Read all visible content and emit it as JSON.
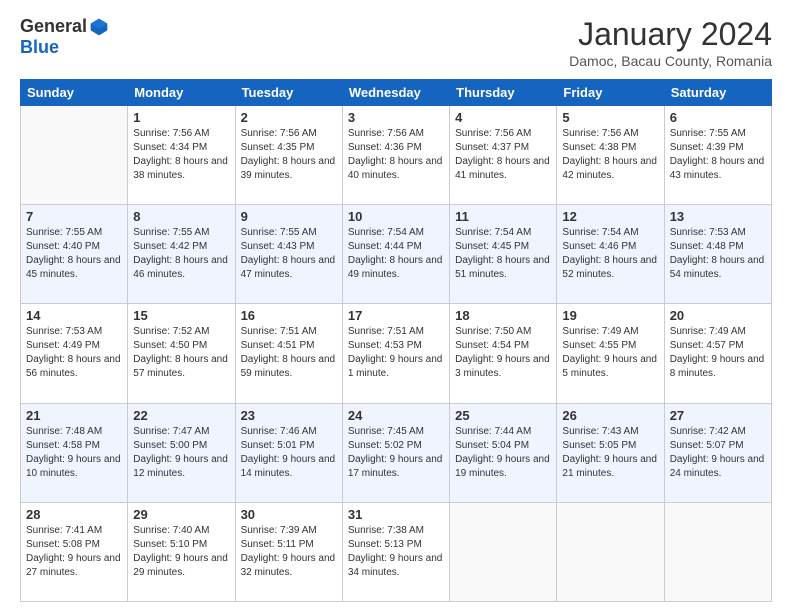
{
  "header": {
    "logo_general": "General",
    "logo_blue": "Blue",
    "month_title": "January 2024",
    "subtitle": "Damoc, Bacau County, Romania"
  },
  "weekdays": [
    "Sunday",
    "Monday",
    "Tuesday",
    "Wednesday",
    "Thursday",
    "Friday",
    "Saturday"
  ],
  "weeks": [
    [
      {
        "day": "",
        "sunrise": "",
        "sunset": "",
        "daylight": ""
      },
      {
        "day": "1",
        "sunrise": "Sunrise: 7:56 AM",
        "sunset": "Sunset: 4:34 PM",
        "daylight": "Daylight: 8 hours and 38 minutes."
      },
      {
        "day": "2",
        "sunrise": "Sunrise: 7:56 AM",
        "sunset": "Sunset: 4:35 PM",
        "daylight": "Daylight: 8 hours and 39 minutes."
      },
      {
        "day": "3",
        "sunrise": "Sunrise: 7:56 AM",
        "sunset": "Sunset: 4:36 PM",
        "daylight": "Daylight: 8 hours and 40 minutes."
      },
      {
        "day": "4",
        "sunrise": "Sunrise: 7:56 AM",
        "sunset": "Sunset: 4:37 PM",
        "daylight": "Daylight: 8 hours and 41 minutes."
      },
      {
        "day": "5",
        "sunrise": "Sunrise: 7:56 AM",
        "sunset": "Sunset: 4:38 PM",
        "daylight": "Daylight: 8 hours and 42 minutes."
      },
      {
        "day": "6",
        "sunrise": "Sunrise: 7:55 AM",
        "sunset": "Sunset: 4:39 PM",
        "daylight": "Daylight: 8 hours and 43 minutes."
      }
    ],
    [
      {
        "day": "7",
        "sunrise": "Sunrise: 7:55 AM",
        "sunset": "Sunset: 4:40 PM",
        "daylight": "Daylight: 8 hours and 45 minutes."
      },
      {
        "day": "8",
        "sunrise": "Sunrise: 7:55 AM",
        "sunset": "Sunset: 4:42 PM",
        "daylight": "Daylight: 8 hours and 46 minutes."
      },
      {
        "day": "9",
        "sunrise": "Sunrise: 7:55 AM",
        "sunset": "Sunset: 4:43 PM",
        "daylight": "Daylight: 8 hours and 47 minutes."
      },
      {
        "day": "10",
        "sunrise": "Sunrise: 7:54 AM",
        "sunset": "Sunset: 4:44 PM",
        "daylight": "Daylight: 8 hours and 49 minutes."
      },
      {
        "day": "11",
        "sunrise": "Sunrise: 7:54 AM",
        "sunset": "Sunset: 4:45 PM",
        "daylight": "Daylight: 8 hours and 51 minutes."
      },
      {
        "day": "12",
        "sunrise": "Sunrise: 7:54 AM",
        "sunset": "Sunset: 4:46 PM",
        "daylight": "Daylight: 8 hours and 52 minutes."
      },
      {
        "day": "13",
        "sunrise": "Sunrise: 7:53 AM",
        "sunset": "Sunset: 4:48 PM",
        "daylight": "Daylight: 8 hours and 54 minutes."
      }
    ],
    [
      {
        "day": "14",
        "sunrise": "Sunrise: 7:53 AM",
        "sunset": "Sunset: 4:49 PM",
        "daylight": "Daylight: 8 hours and 56 minutes."
      },
      {
        "day": "15",
        "sunrise": "Sunrise: 7:52 AM",
        "sunset": "Sunset: 4:50 PM",
        "daylight": "Daylight: 8 hours and 57 minutes."
      },
      {
        "day": "16",
        "sunrise": "Sunrise: 7:51 AM",
        "sunset": "Sunset: 4:51 PM",
        "daylight": "Daylight: 8 hours and 59 minutes."
      },
      {
        "day": "17",
        "sunrise": "Sunrise: 7:51 AM",
        "sunset": "Sunset: 4:53 PM",
        "daylight": "Daylight: 9 hours and 1 minute."
      },
      {
        "day": "18",
        "sunrise": "Sunrise: 7:50 AM",
        "sunset": "Sunset: 4:54 PM",
        "daylight": "Daylight: 9 hours and 3 minutes."
      },
      {
        "day": "19",
        "sunrise": "Sunrise: 7:49 AM",
        "sunset": "Sunset: 4:55 PM",
        "daylight": "Daylight: 9 hours and 5 minutes."
      },
      {
        "day": "20",
        "sunrise": "Sunrise: 7:49 AM",
        "sunset": "Sunset: 4:57 PM",
        "daylight": "Daylight: 9 hours and 8 minutes."
      }
    ],
    [
      {
        "day": "21",
        "sunrise": "Sunrise: 7:48 AM",
        "sunset": "Sunset: 4:58 PM",
        "daylight": "Daylight: 9 hours and 10 minutes."
      },
      {
        "day": "22",
        "sunrise": "Sunrise: 7:47 AM",
        "sunset": "Sunset: 5:00 PM",
        "daylight": "Daylight: 9 hours and 12 minutes."
      },
      {
        "day": "23",
        "sunrise": "Sunrise: 7:46 AM",
        "sunset": "Sunset: 5:01 PM",
        "daylight": "Daylight: 9 hours and 14 minutes."
      },
      {
        "day": "24",
        "sunrise": "Sunrise: 7:45 AM",
        "sunset": "Sunset: 5:02 PM",
        "daylight": "Daylight: 9 hours and 17 minutes."
      },
      {
        "day": "25",
        "sunrise": "Sunrise: 7:44 AM",
        "sunset": "Sunset: 5:04 PM",
        "daylight": "Daylight: 9 hours and 19 minutes."
      },
      {
        "day": "26",
        "sunrise": "Sunrise: 7:43 AM",
        "sunset": "Sunset: 5:05 PM",
        "daylight": "Daylight: 9 hours and 21 minutes."
      },
      {
        "day": "27",
        "sunrise": "Sunrise: 7:42 AM",
        "sunset": "Sunset: 5:07 PM",
        "daylight": "Daylight: 9 hours and 24 minutes."
      }
    ],
    [
      {
        "day": "28",
        "sunrise": "Sunrise: 7:41 AM",
        "sunset": "Sunset: 5:08 PM",
        "daylight": "Daylight: 9 hours and 27 minutes."
      },
      {
        "day": "29",
        "sunrise": "Sunrise: 7:40 AM",
        "sunset": "Sunset: 5:10 PM",
        "daylight": "Daylight: 9 hours and 29 minutes."
      },
      {
        "day": "30",
        "sunrise": "Sunrise: 7:39 AM",
        "sunset": "Sunset: 5:11 PM",
        "daylight": "Daylight: 9 hours and 32 minutes."
      },
      {
        "day": "31",
        "sunrise": "Sunrise: 7:38 AM",
        "sunset": "Sunset: 5:13 PM",
        "daylight": "Daylight: 9 hours and 34 minutes."
      },
      {
        "day": "",
        "sunrise": "",
        "sunset": "",
        "daylight": ""
      },
      {
        "day": "",
        "sunrise": "",
        "sunset": "",
        "daylight": ""
      },
      {
        "day": "",
        "sunrise": "",
        "sunset": "",
        "daylight": ""
      }
    ]
  ]
}
